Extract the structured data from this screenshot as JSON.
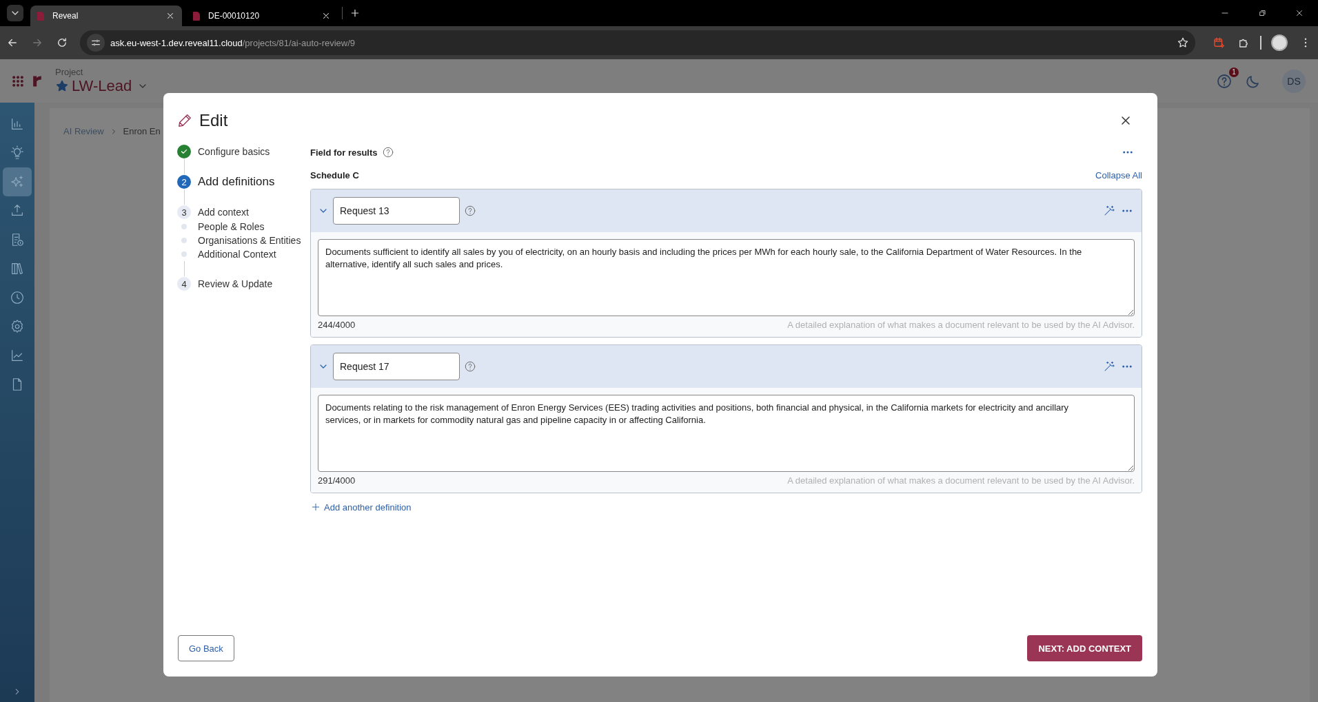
{
  "browser": {
    "tabs": [
      {
        "title": "Reveal",
        "selected": true
      },
      {
        "title": "DE-00010120",
        "selected": false
      }
    ],
    "url_host": "ask.eu-west-1.dev.reveal11.cloud",
    "url_path": "/projects/81/ai-auto-review/9"
  },
  "header": {
    "project_label": "Project",
    "project_name": "LW-Lead",
    "notification_count": "1",
    "avatar": "DS"
  },
  "nav_items": [
    {
      "kind": "chart",
      "selected": false
    },
    {
      "kind": "bulb",
      "selected": false
    },
    {
      "kind": "sparkle",
      "selected": true
    },
    {
      "kind": "upload",
      "selected": false
    },
    {
      "kind": "doc-info",
      "selected": false
    },
    {
      "kind": "library",
      "selected": false
    },
    {
      "kind": "clock",
      "selected": false
    },
    {
      "kind": "gear",
      "selected": false
    },
    {
      "kind": "line-chart",
      "selected": false
    },
    {
      "kind": "file",
      "selected": false
    }
  ],
  "breadcrumb": [
    "AI Review",
    "Enron En"
  ],
  "modal": {
    "title": "Edit",
    "steps": [
      {
        "label": "Configure basics",
        "done": true,
        "current": false
      },
      {
        "number": "2",
        "label": "Add definitions",
        "done": false,
        "current": true
      },
      {
        "number": "3",
        "label": "Add context",
        "done": false,
        "current": false,
        "children": [
          {
            "label": "People & Roles"
          },
          {
            "label": "Organisations & Entities"
          },
          {
            "label": "Additional Context"
          }
        ]
      },
      {
        "number": "4",
        "label": "Review & Update",
        "done": false,
        "current": false
      }
    ],
    "field_label": "Field for results",
    "field_value": "Schedule C",
    "collapse_all": "Collapse All",
    "definitions": [
      {
        "name": "Request 13",
        "expanded": true,
        "text": "Documents sufficient to identify all sales by you of electricity, on an hourly basis and including the prices per MWh for each hourly sale, to the California Department of Water Resources. In the alternative, identify all such sales and prices.",
        "count": "244/4000",
        "hint": "A detailed explanation of what makes a document relevant to be used by the AI Advisor."
      },
      {
        "name": "Request 17",
        "expanded": true,
        "text": "Documents relating to the risk management of Enron Energy Services (EES) trading activities and positions, both financial and physical, in the California markets for electricity and ancillary services, or in markets for commodity natural gas and pipeline capacity in or affecting California.",
        "count": "291/4000",
        "hint": "A detailed explanation of what makes a document relevant to be used by the AI Advisor."
      }
    ],
    "add_definition": "Add another definition",
    "back_button": "Go Back",
    "next_button": "NEXT: ADD CONTEXT"
  }
}
